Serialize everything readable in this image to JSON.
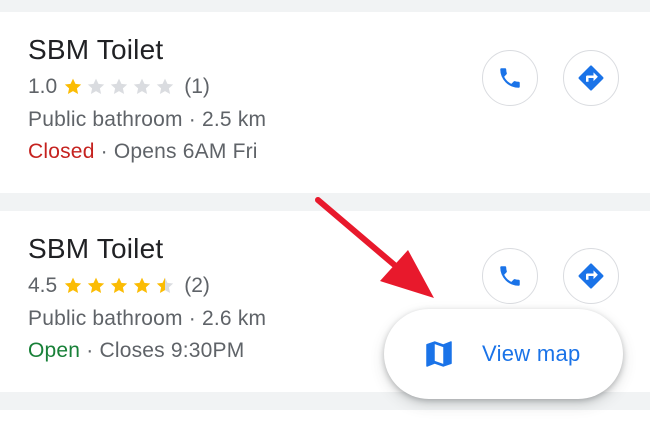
{
  "results": [
    {
      "name": "SBM Toilet",
      "rating": "1.0",
      "stars_filled": 1.0,
      "review_count": "(1)",
      "category_distance": "Public bathroom · 2.5 km",
      "status": "Closed",
      "status_color": "#c5221f",
      "hours": "· Opens 6AM Fri"
    },
    {
      "name": "SBM Toilet",
      "rating": "4.5",
      "stars_filled": 4.5,
      "review_count": "(2)",
      "category_distance": "Public bathroom · 2.6 km",
      "status": "Open",
      "status_color": "#188038",
      "hours": "· Closes 9:30PM"
    }
  ],
  "actions": {
    "call_icon": "phone-icon",
    "directions_icon": "directions-icon"
  },
  "view_map": {
    "label": "View map",
    "icon": "map-icon"
  },
  "colors": {
    "accent": "#1a73e8",
    "star": "#fbbc04",
    "star_empty": "#dadce0",
    "annotation_arrow": "#e8192c"
  }
}
